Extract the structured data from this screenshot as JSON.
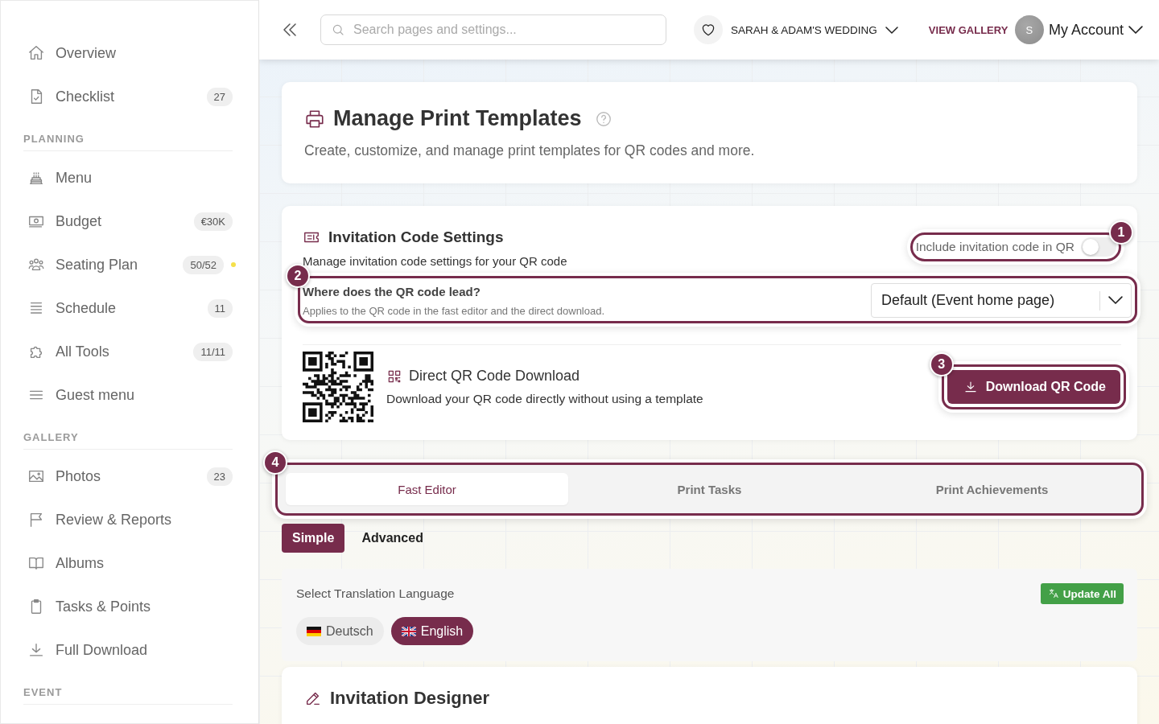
{
  "sidebar": {
    "sections": [
      {
        "items": [
          {
            "label": "Overview"
          },
          {
            "label": "Checklist",
            "badge": "27"
          }
        ]
      },
      {
        "heading": "PLANNING",
        "items": [
          {
            "label": "Menu"
          },
          {
            "label": "Budget",
            "badge": "€30K"
          },
          {
            "label": "Seating Plan",
            "badge": "50/52",
            "color": "#f5e04a"
          },
          {
            "label": "Schedule",
            "badge": "11"
          },
          {
            "label": "All Tools",
            "badge": "11/11"
          },
          {
            "label": "Guest menu"
          }
        ]
      },
      {
        "heading": "GALLERY",
        "items": [
          {
            "label": "Photos",
            "badge": "23"
          },
          {
            "label": "Review & Reports"
          },
          {
            "label": "Albums"
          },
          {
            "label": "Tasks & Points"
          },
          {
            "label": "Full Download"
          }
        ]
      },
      {
        "heading": "EVENT"
      }
    ]
  },
  "header": {
    "search": {
      "placeholder": "Search pages and settings..."
    },
    "event": "SARAH & ADAM'S WEDDING",
    "gallery_link": "VIEW GALLERY",
    "account": {
      "initial": "S",
      "label": "My Account"
    }
  },
  "page": {
    "title": "Manage Print Templates",
    "subtitle": "Create, customize, and manage print templates for QR codes and more."
  },
  "invitation_settings": {
    "title": "Invitation Code Settings",
    "subtitle": "Manage invitation code settings for your QR code",
    "toggle": {
      "label": "Include invitation code in QR",
      "on": false,
      "callout": "1"
    },
    "destination": {
      "label": "Where does the QR code lead?",
      "hint": "Applies to the QR code in the fast editor and the direct download.",
      "value": "Default (Event home page)",
      "callout": "2"
    },
    "direct_download": {
      "title": "Direct QR Code Download",
      "description": "Download your QR code directly without using a template",
      "button": "Download QR Code",
      "callout": "3"
    }
  },
  "tabs": {
    "callout": "4",
    "items": [
      {
        "label": "Fast Editor",
        "selected": true
      },
      {
        "label": "Print Tasks",
        "selected": false
      },
      {
        "label": "Print Achievements",
        "selected": false
      }
    ]
  },
  "modes": [
    {
      "label": "Simple",
      "selected": true
    },
    {
      "label": "Advanced",
      "selected": false
    }
  ],
  "translation": {
    "label": "Select Translation Language",
    "update_button": "Update All",
    "languages": [
      {
        "label": "Deutsch",
        "selected": false
      },
      {
        "label": "English",
        "selected": true
      }
    ]
  },
  "designer": {
    "title": "Invitation Designer"
  }
}
